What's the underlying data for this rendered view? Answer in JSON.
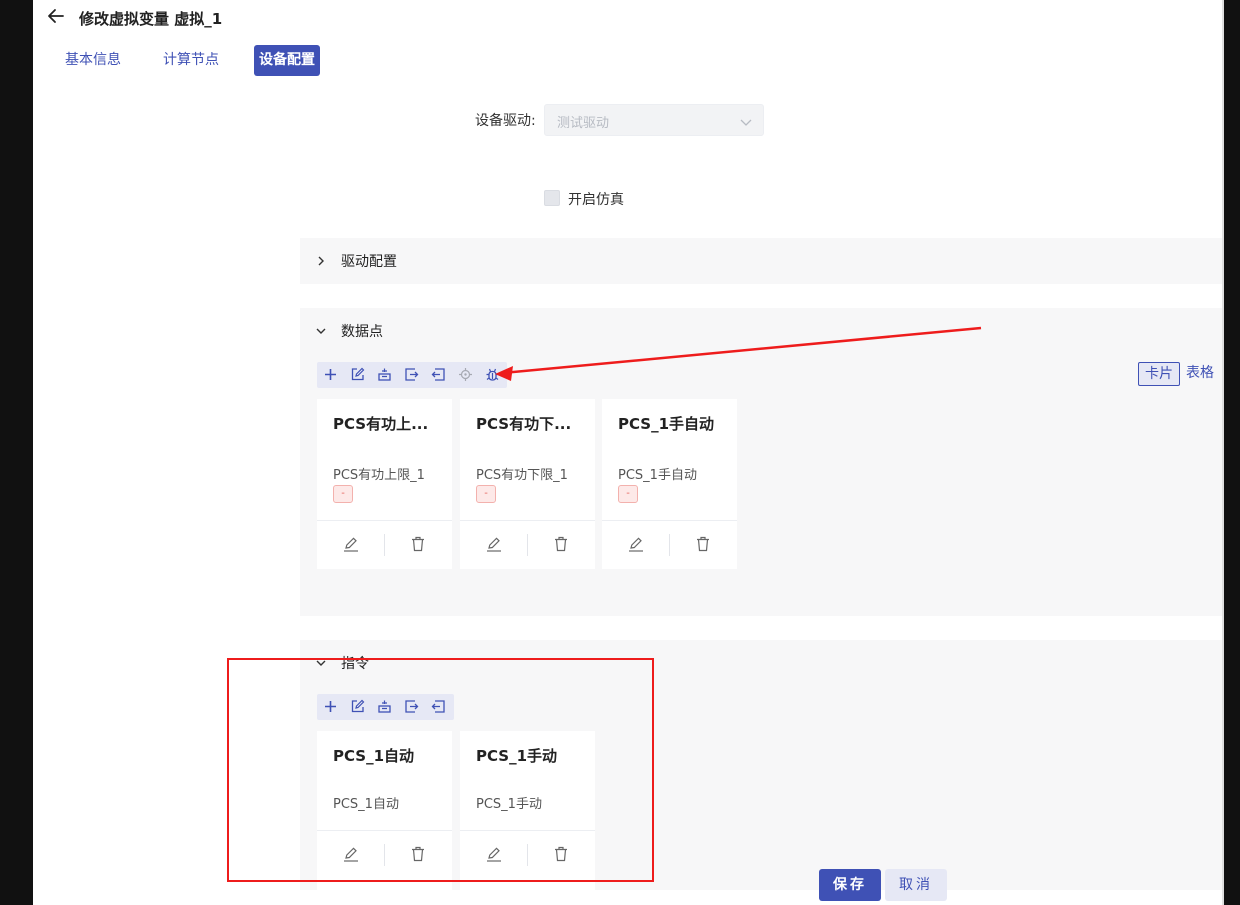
{
  "header": {
    "title": "修改虚拟变量 虚拟_1"
  },
  "tabs": [
    {
      "label": "基本信息",
      "active": false
    },
    {
      "label": "计算节点",
      "active": false
    },
    {
      "label": "设备配置",
      "active": true
    }
  ],
  "form": {
    "driver_label": "设备驱动:",
    "driver_value": "测试驱动",
    "simulation_label": "开启仿真",
    "simulation_checked": false
  },
  "panels": {
    "driver_config": {
      "title": "驱动配置",
      "expanded": false
    },
    "data_points": {
      "title": "数据点",
      "expanded": true,
      "toolbar_icons": [
        "add-icon",
        "edit-icon",
        "batch-icon",
        "export-icon",
        "import-icon",
        "locate-icon",
        "debug-icon"
      ],
      "view_options": [
        "卡片",
        "表格"
      ],
      "active_view": "卡片",
      "cards": [
        {
          "title": "PCS有功上...",
          "subtitle": "PCS有功上限_1",
          "tag": "-"
        },
        {
          "title": "PCS有功下...",
          "subtitle": "PCS有功下限_1",
          "tag": "-"
        },
        {
          "title": "PCS_1手自动",
          "subtitle": "PCS_1手自动",
          "tag": "-"
        }
      ]
    },
    "commands": {
      "title": "指令",
      "expanded": true,
      "toolbar_icons": [
        "add-icon",
        "edit-icon",
        "batch-icon",
        "export-icon",
        "import-icon"
      ],
      "cards": [
        {
          "title": "PCS_1自动",
          "subtitle": "PCS_1自动"
        },
        {
          "title": "PCS_1手动",
          "subtitle": "PCS_1手动"
        }
      ]
    }
  },
  "footer": {
    "save_label": "保存",
    "cancel_label": "取消"
  },
  "colors": {
    "primary": "#3f51b5",
    "annotation_red": "#ee1c1c",
    "panel_bg": "#f7f7f8"
  }
}
